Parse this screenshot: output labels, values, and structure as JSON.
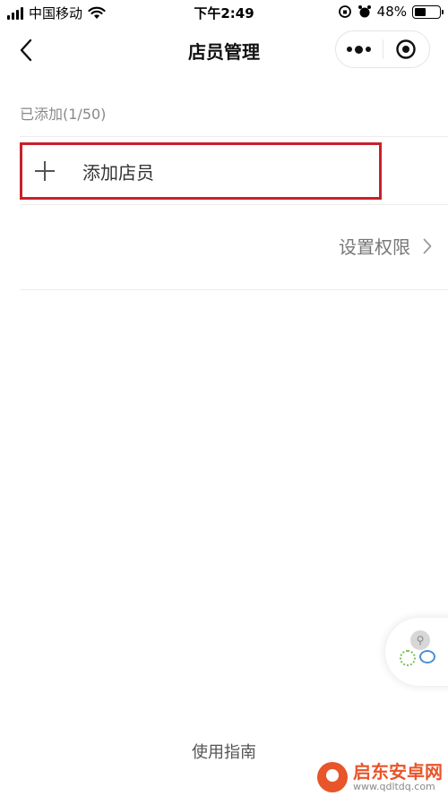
{
  "status_bar": {
    "carrier": "中国移动",
    "time": "下午2:49",
    "battery_text": "48%",
    "battery_level": 0.48
  },
  "nav": {
    "title": "店员管理"
  },
  "content": {
    "section_label": "已添加(1/50)",
    "add_button_label": "添加店员",
    "permissions_label": "设置权限"
  },
  "footer": {
    "guide_label": "使用指南"
  },
  "watermark": {
    "title": "启东安卓网",
    "url": "www.qdltdq.com"
  },
  "colors": {
    "highlight_border": "#c8202a",
    "brand_orange": "#e8552a"
  }
}
